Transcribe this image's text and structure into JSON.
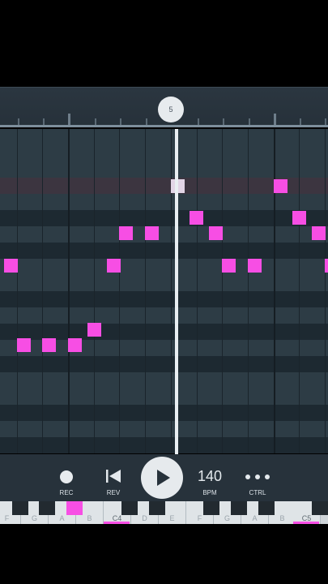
{
  "timeline": {
    "position_label": "5"
  },
  "transport": {
    "rec_label": "REC",
    "rev_label": "REV",
    "bpm_value": "140",
    "bpm_label": "BPM",
    "ctrl_label": "CTRL"
  },
  "keyboard": {
    "keys": [
      "F",
      "G",
      "A",
      "B",
      "C4",
      "D",
      "E",
      "F",
      "G",
      "A",
      "B",
      "C5"
    ]
  },
  "icons": {
    "rec": "record-icon",
    "rev": "skip-back-icon",
    "play": "play-icon",
    "ctrl": "more-dots-icon"
  },
  "colors": {
    "note": "#f74ee4",
    "accent": "#f74ee4",
    "background": "#000000",
    "panel": "#27323b"
  }
}
